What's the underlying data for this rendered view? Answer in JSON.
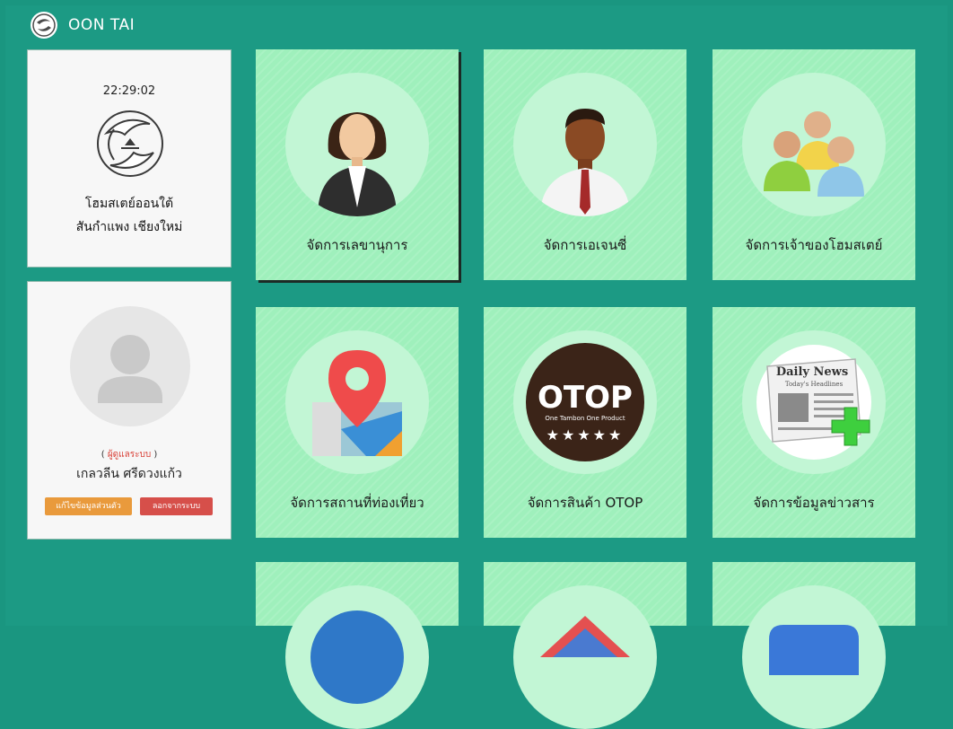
{
  "header": {
    "brand_name": "OON TAI"
  },
  "clock_card": {
    "time": "22:29:02",
    "homestay_name": "โฮมสเตย์ออนใต้",
    "location": "สันกำแพง เชียงใหม่"
  },
  "user_card": {
    "role_open": "( ",
    "role": "ผู้ดูแลระบบ",
    "role_close": " )",
    "name": "เกลวลีน ศรีดวงแก้ว",
    "edit_button": "แก้ไขข้อมูลส่วนตัว",
    "logout_button": "ลอกจากระบบ"
  },
  "tiles": [
    {
      "label": "จัดการเลขานุการ",
      "icon": "secretary-icon"
    },
    {
      "label": "จัดการเอเจนซี่",
      "icon": "agency-icon"
    },
    {
      "label": "จัดการเจ้าของโฮมสเตย์",
      "icon": "homestay-owners-icon"
    },
    {
      "label": "จัดการสถานที่ท่องเที่ยว",
      "icon": "map-pin-icon"
    },
    {
      "label": "จัดการสินค้า OTOP",
      "icon": "otop-icon"
    },
    {
      "label": "จัดการข้อมูลข่าวสาร",
      "icon": "news-icon"
    }
  ],
  "otop_badge": {
    "title": "OTOP",
    "subtitle": "One Tambon One Product",
    "stars": "★★★★★"
  },
  "news_icon": {
    "masthead": "Daily News",
    "headline": "Today's Headlines"
  },
  "colors": {
    "background": "#1a9680",
    "tile": "#9ff0bc",
    "tile_circle": "#c2f6d5",
    "edit_button": "#e99a3c",
    "logout_button": "#d64f4a"
  }
}
